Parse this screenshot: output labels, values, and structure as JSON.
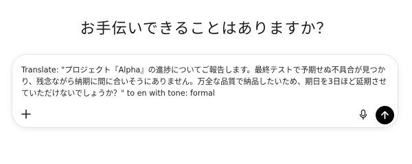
{
  "heading": "お手伝いできることはありますか？",
  "composer": {
    "input_value": "Translate: \"プロジェクト『Alpha』の進捗についてご報告します。最終テストで予期せぬ不具合が見つかり、残念ながら納期に間に合いそうにありません。万全な品質で納品したいため、期日を3日ほど延期させていただけないでしょうか？\" to en with tone: formal"
  },
  "icons": {
    "add": "plus-icon",
    "voice": "microphone-icon",
    "send": "arrow-up-icon"
  },
  "colors": {
    "send_button_bg": "#000000",
    "composer_border": "#e6e6e6"
  }
}
